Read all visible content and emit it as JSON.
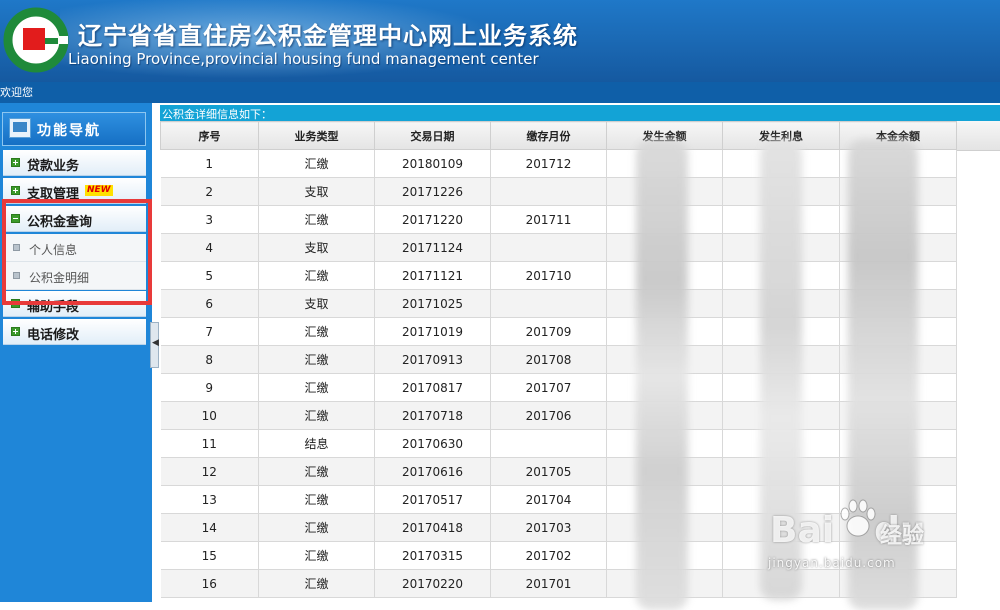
{
  "header": {
    "title_cn": "辽宁省省直住房公积金管理中心网上业务系统",
    "title_en": "Liaoning Province,provincial housing fund management center",
    "logo_icon": "housing-fund-logo",
    "bg_color": "#1a66b0"
  },
  "welcome": {
    "text": "欢迎您"
  },
  "sidebar": {
    "nav_title": "功能导航",
    "items": [
      {
        "label": "贷款业务",
        "icon": "plus-square-icon"
      },
      {
        "label": "支取管理",
        "badge": "NEW",
        "icon": "plus-square-icon"
      },
      {
        "label": "公积金查询",
        "icon": "minus-square-icon",
        "expanded": true,
        "children": [
          {
            "label": "个人信息"
          },
          {
            "label": "公积金明细"
          }
        ]
      },
      {
        "label": "辅助手段",
        "icon": "minus-square-icon"
      },
      {
        "label": "电话修改",
        "icon": "plus-square-icon"
      }
    ],
    "highlight_color": "#e83a3a"
  },
  "main": {
    "title": "公积金详细信息如下：",
    "columns": [
      "序号",
      "业务类型",
      "交易日期",
      "缴存月份",
      "发生金额",
      "发生利息",
      "本金余额"
    ],
    "rows": [
      [
        "1",
        "汇缴",
        "20180109",
        "201712"
      ],
      [
        "2",
        "支取",
        "20171226",
        ""
      ],
      [
        "3",
        "汇缴",
        "20171220",
        "201711"
      ],
      [
        "4",
        "支取",
        "20171124",
        ""
      ],
      [
        "5",
        "汇缴",
        "20171121",
        "201710"
      ],
      [
        "6",
        "支取",
        "20171025",
        ""
      ],
      [
        "7",
        "汇缴",
        "20171019",
        "201709"
      ],
      [
        "8",
        "汇缴",
        "20170913",
        "201708"
      ],
      [
        "9",
        "汇缴",
        "20170817",
        "201707"
      ],
      [
        "10",
        "汇缴",
        "20170718",
        "201706"
      ],
      [
        "11",
        "结息",
        "20170630",
        ""
      ],
      [
        "12",
        "汇缴",
        "20170616",
        "201705"
      ],
      [
        "13",
        "汇缴",
        "20170517",
        "201704"
      ],
      [
        "14",
        "汇缴",
        "20170418",
        "201703"
      ],
      [
        "15",
        "汇缴",
        "20170315",
        "201702"
      ],
      [
        "16",
        "汇缴",
        "20170220",
        "201701"
      ]
    ],
    "accent_color": "#13a3d6"
  },
  "watermark": {
    "brand": "Bai",
    "brand2": "du",
    "sub": "经验",
    "url": "jingyan.baidu.com"
  }
}
